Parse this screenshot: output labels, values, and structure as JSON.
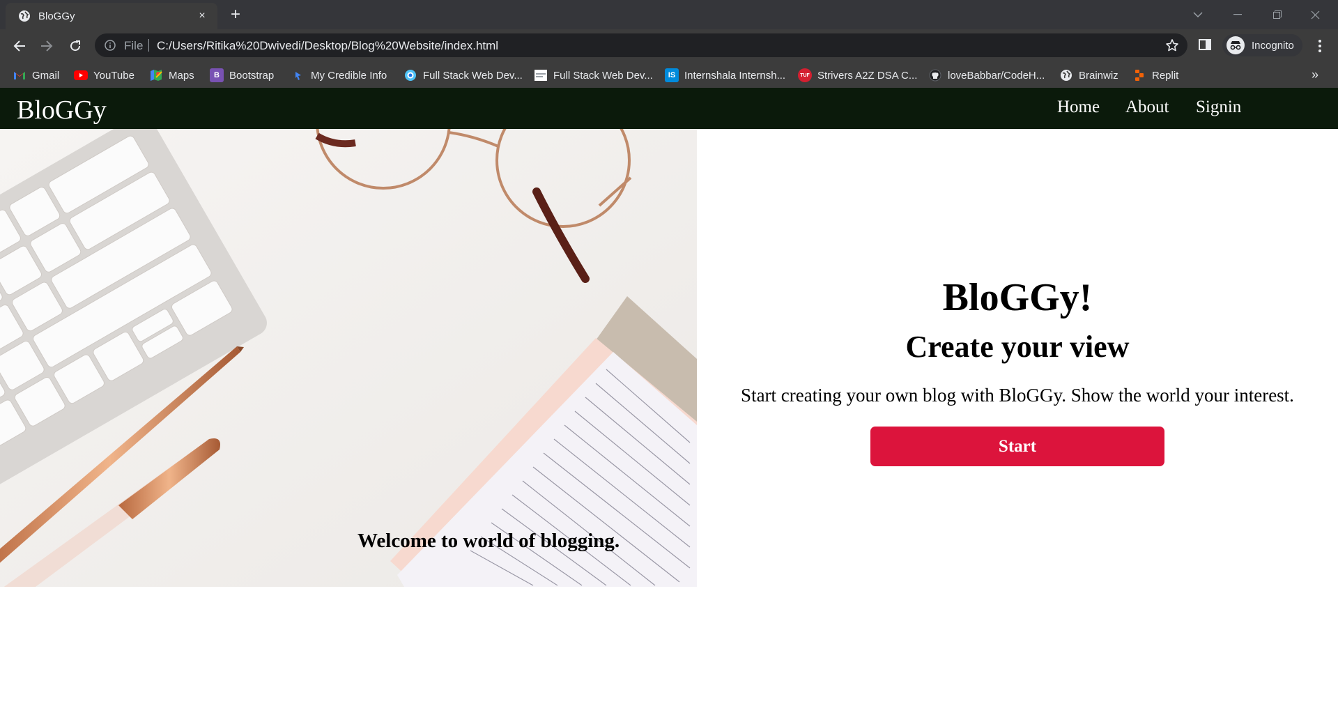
{
  "browser": {
    "tab": {
      "title": "BloGGy",
      "close_icon": "×"
    },
    "new_tab_icon": "+",
    "address": {
      "scheme": "File",
      "url": "C:/Users/Ritika%20Dwivedi/Desktop/Blog%20Website/index.html"
    },
    "profile": {
      "label": "Incognito"
    },
    "bookmarks": [
      {
        "label": "Gmail",
        "icon": "gmail-icon",
        "color": "#ea4335"
      },
      {
        "label": "YouTube",
        "icon": "youtube-icon",
        "color": "#ff0000"
      },
      {
        "label": "Maps",
        "icon": "maps-icon",
        "color": "#34a853"
      },
      {
        "label": "Bootstrap",
        "icon": "bootstrap-icon",
        "color": "#7952b3"
      },
      {
        "label": "My Credible Info",
        "icon": "credible-icon",
        "color": "#4285f4"
      },
      {
        "label": "Full Stack Web Dev...",
        "icon": "globe-blue-icon",
        "color": "#1a73e8"
      },
      {
        "label": "Full Stack Web Dev...",
        "icon": "page-icon",
        "color": "#e8eaed"
      },
      {
        "label": "Internshala Internsh...",
        "icon": "internshala-icon",
        "color": "#008bdc"
      },
      {
        "label": "Strivers A2Z DSA C...",
        "icon": "tuf-icon",
        "color": "#d41f30"
      },
      {
        "label": "loveBabbar/CodeH...",
        "icon": "github-icon",
        "color": "#202124"
      },
      {
        "label": "Brainwiz",
        "icon": "globe-icon",
        "color": "#9aa0a6"
      },
      {
        "label": "Replit",
        "icon": "replit-icon",
        "color": "#f26207"
      }
    ],
    "more_bookmarks": "»"
  },
  "site": {
    "brand": "BloGGy",
    "nav": [
      "Home",
      "About",
      "Signin"
    ],
    "nav_bg": "#0b1a0b"
  },
  "hero": {
    "image_caption": "Welcome to world of blogging.",
    "title": "BloGGy!",
    "subtitle": "Create your view",
    "description": "Start creating your own blog with BloGGy. Show the world your interest.",
    "button_label": "Start",
    "button_color": "#dc143c"
  }
}
